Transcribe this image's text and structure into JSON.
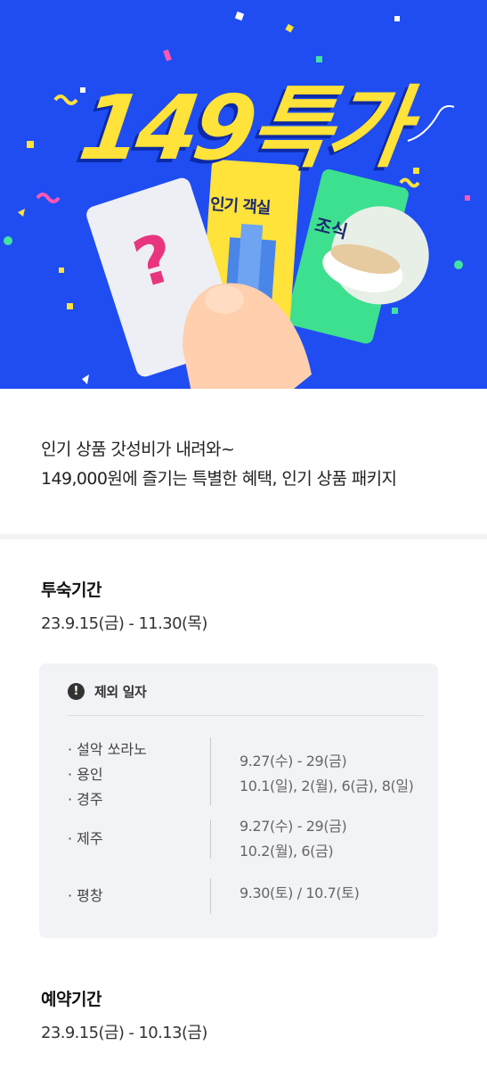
{
  "hero": {
    "title": "149특가",
    "ticket_mystery": "?",
    "ticket_room": "인기 객실",
    "ticket_breakfast": "조식"
  },
  "intro": {
    "line1": "인기 상품 갓성비가 내려와~",
    "line2": "149,000원에 즐기는 특별한 혜택, 인기 상품 패키지"
  },
  "stay_period": {
    "title": "투숙기간",
    "dates": "23.9.15(금) - 11.30(목)"
  },
  "exclusion": {
    "icon": "!",
    "title": "제외 일자",
    "rows": [
      {
        "places": [
          "설악 쏘라노",
          "용인",
          "경주"
        ],
        "dates": [
          "9.27(수) - 29(금)",
          "10.1(일), 2(월), 6(금), 8(일)"
        ]
      },
      {
        "places": [
          "제주"
        ],
        "dates": [
          "9.27(수) - 29(금)",
          "10.2(월), 6(금)"
        ]
      },
      {
        "places": [
          "평창"
        ],
        "dates": [
          "9.30(토) / 10.7(토)"
        ]
      }
    ]
  },
  "booking_period": {
    "title": "예약기간",
    "dates": "23.9.15(금) - 10.13(금)"
  },
  "colors": {
    "hero_bg": "#1f4df2",
    "title_yellow": "#ffe23a",
    "ticket_green": "#3de08f"
  }
}
